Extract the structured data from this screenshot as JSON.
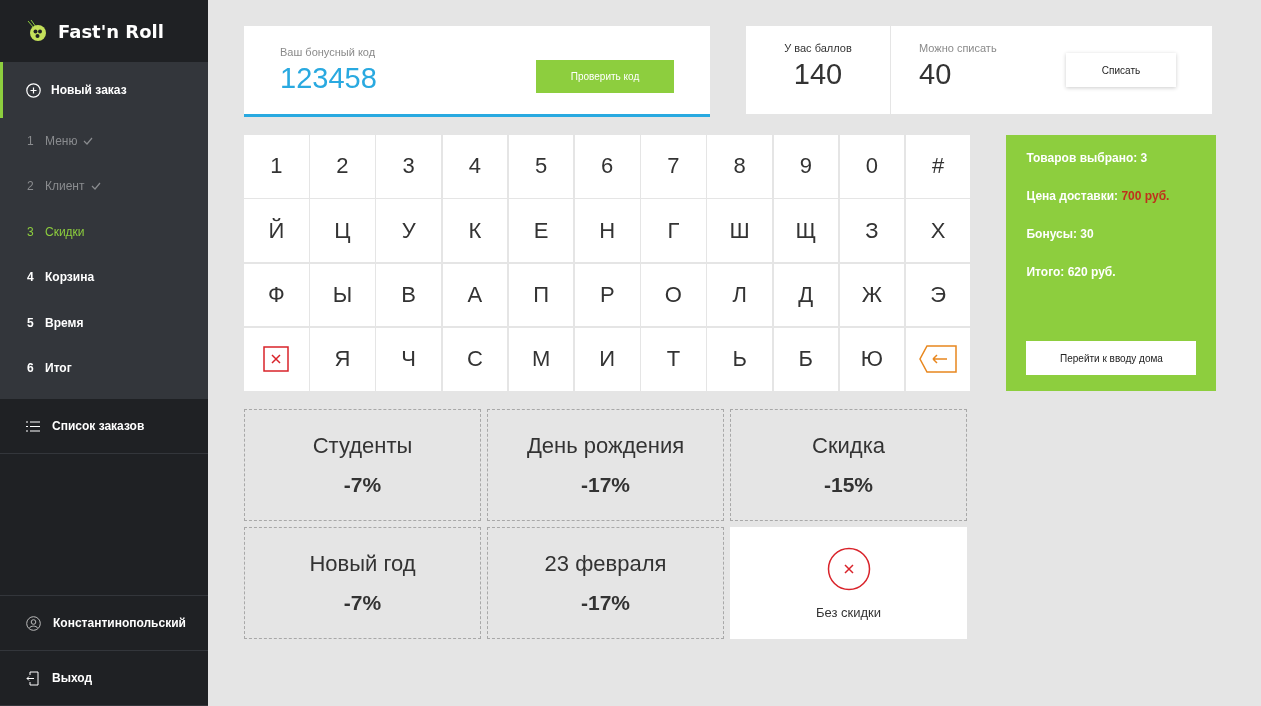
{
  "sidebar": {
    "brand": "Fast'n Roll",
    "new_order": {
      "label": "Новый заказ",
      "selected": true,
      "steps": [
        {
          "number": "1",
          "label": "Меню",
          "done": true,
          "selected": false
        },
        {
          "number": "2",
          "label": "Клиент",
          "done": true,
          "selected": false
        },
        {
          "number": "3",
          "label": "Скидки",
          "done": false,
          "selected": true
        },
        {
          "number": "4",
          "label": "Корзина",
          "done": false,
          "selected": false
        },
        {
          "number": "5",
          "label": "Время",
          "done": false,
          "selected": false
        },
        {
          "number": "6",
          "label": "Итог",
          "done": false,
          "selected": false
        }
      ]
    },
    "orders_link": "Список заказов",
    "user": "Константинопольский",
    "logout": "Выход"
  },
  "bonus_code": {
    "label": "Ваш бонусный код",
    "value": "123458",
    "button": "Проверить код"
  },
  "points": {
    "balance_label": "У вас баллов",
    "balance": "140",
    "writeoff_label": "Можно списать",
    "writeoff": "40",
    "button": "Списать"
  },
  "keyboard": {
    "rows": [
      [
        {
          "kind": "char",
          "label": "1"
        },
        {
          "kind": "char",
          "label": "2"
        },
        {
          "kind": "char",
          "label": "3"
        },
        {
          "kind": "char",
          "label": "4"
        },
        {
          "kind": "char",
          "label": "5"
        },
        {
          "kind": "char",
          "label": "6"
        },
        {
          "kind": "char",
          "label": "7"
        },
        {
          "kind": "char",
          "label": "8"
        },
        {
          "kind": "char",
          "label": "9"
        },
        {
          "kind": "char",
          "label": "0"
        },
        {
          "kind": "char",
          "label": "#"
        }
      ],
      [
        {
          "kind": "char",
          "label": "Й"
        },
        {
          "kind": "char",
          "label": "Ц"
        },
        {
          "kind": "char",
          "label": "У"
        },
        {
          "kind": "char",
          "label": "К"
        },
        {
          "kind": "char",
          "label": "Е"
        },
        {
          "kind": "char",
          "label": "Н"
        },
        {
          "kind": "char",
          "label": "Г"
        },
        {
          "kind": "char",
          "label": "Ш"
        },
        {
          "kind": "char",
          "label": "Щ"
        },
        {
          "kind": "char",
          "label": "З"
        },
        {
          "kind": "char",
          "label": "Х"
        }
      ],
      [
        {
          "kind": "char",
          "label": "Ф"
        },
        {
          "kind": "char",
          "label": "Ы"
        },
        {
          "kind": "char",
          "label": "В"
        },
        {
          "kind": "char",
          "label": "А"
        },
        {
          "kind": "char",
          "label": "П"
        },
        {
          "kind": "char",
          "label": "Р"
        },
        {
          "kind": "char",
          "label": "О"
        },
        {
          "kind": "char",
          "label": "Л"
        },
        {
          "kind": "char",
          "label": "Д"
        },
        {
          "kind": "char",
          "label": "Ж"
        },
        {
          "kind": "char",
          "label": "Э"
        }
      ],
      [
        {
          "kind": "clear"
        },
        {
          "kind": "char",
          "label": "Я"
        },
        {
          "kind": "char",
          "label": "Ч"
        },
        {
          "kind": "char",
          "label": "С"
        },
        {
          "kind": "char",
          "label": "М"
        },
        {
          "kind": "char",
          "label": "И"
        },
        {
          "kind": "char",
          "label": "Т"
        },
        {
          "kind": "char",
          "label": "Ь"
        },
        {
          "kind": "char",
          "label": "Б"
        },
        {
          "kind": "char",
          "label": "Ю"
        },
        {
          "kind": "backspace"
        }
      ]
    ]
  },
  "summary": {
    "lines": [
      {
        "label": "Товаров выбрано:",
        "value": "3",
        "highlight": false
      },
      {
        "label": "Цена доставки:",
        "value": "700 руб.",
        "highlight": true
      },
      {
        "label": "Бонусы:",
        "value": "30",
        "highlight": false
      },
      {
        "label": "Итого:",
        "value": "620 руб.",
        "highlight": false
      }
    ],
    "button": "Перейти к вводу дома"
  },
  "discounts": [
    {
      "kind": "discount",
      "name": "Студенты",
      "amount": "-7%",
      "selected": false
    },
    {
      "kind": "discount",
      "name": "День рождения",
      "amount": "-17%",
      "selected": false
    },
    {
      "kind": "discount",
      "name": "Скидка",
      "amount": "-15%",
      "selected": false
    },
    {
      "kind": "discount",
      "name": "Новый год",
      "amount": "-7%",
      "selected": false
    },
    {
      "kind": "discount",
      "name": "23 февраля",
      "amount": "-17%",
      "selected": false
    },
    {
      "kind": "none",
      "name": "Без скидки",
      "selected": true
    }
  ]
}
